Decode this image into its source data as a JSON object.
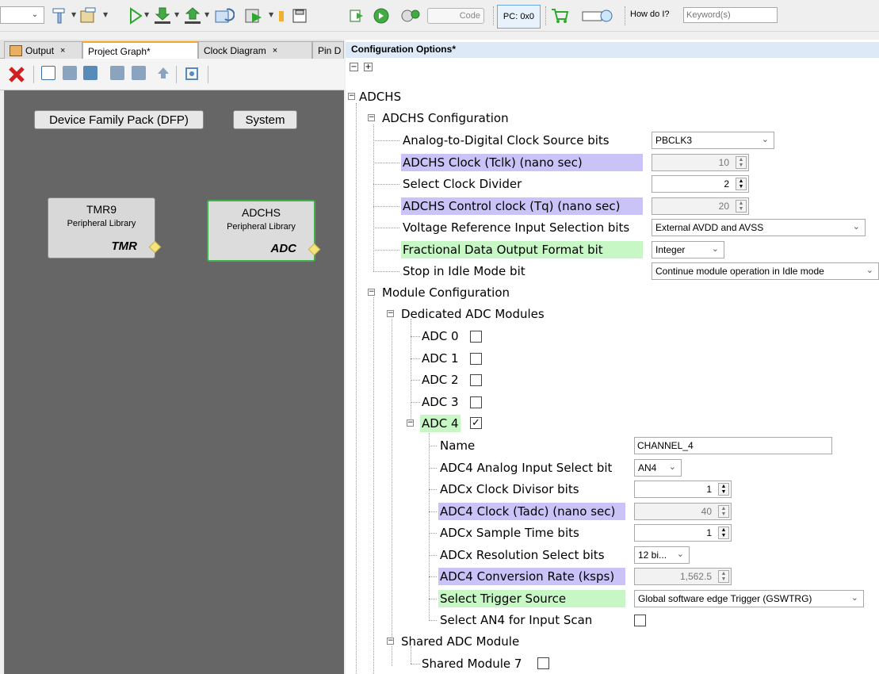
{
  "toolbar": {
    "pc_label": "PC: 0x0",
    "code_label": "Code",
    "how_do_i": "How do I?",
    "search_placeholder": "Keyword(s)"
  },
  "tabs": [
    {
      "label": "Output",
      "close": "×"
    },
    {
      "label": "Project Graph*",
      "close": ""
    },
    {
      "label": "Clock Diagram",
      "close": "×"
    },
    {
      "label": "Pin D",
      "close": ""
    }
  ],
  "graph": {
    "dfp_button": "Device Family Pack (DFP)",
    "system_button": "System",
    "nodes": [
      {
        "title": "TMR9",
        "subtitle": "Peripheral Library",
        "badge": "TMR"
      },
      {
        "title": "ADCHS",
        "subtitle": "Peripheral Library",
        "badge": "ADC"
      }
    ]
  },
  "config": {
    "header": "Configuration Options*",
    "collapse_all": "−",
    "expand_all": "+",
    "root": "ADCHS",
    "adchs_config": "ADCHS Configuration",
    "items": [
      {
        "label": "Analog-to-Digital Clock Source bits",
        "type": "select",
        "value": "PBCLK3",
        "hl": ""
      },
      {
        "label": "ADCHS Clock (Tclk) (nano sec)",
        "type": "spin-ro",
        "value": "10",
        "hl": "blue"
      },
      {
        "label": "Select Clock Divider",
        "type": "spin",
        "value": "2",
        "hl": ""
      },
      {
        "label": "ADCHS Control clock (Tq) (nano sec)",
        "type": "spin-ro",
        "value": "20",
        "hl": "blue"
      },
      {
        "label": "Voltage Reference Input Selection bits",
        "type": "select",
        "value": "External AVDD and AVSS",
        "hl": ""
      },
      {
        "label": "Fractional Data Output Format bit",
        "type": "select",
        "value": "Integer",
        "hl": "green"
      },
      {
        "label": "Stop in Idle Mode bit",
        "type": "select",
        "value": "Continue module operation in Idle mode",
        "hl": ""
      }
    ],
    "module_config": "Module Configuration",
    "dedicated": "Dedicated ADC Modules",
    "adc_list": [
      {
        "label": "ADC 0",
        "checked": false
      },
      {
        "label": "ADC 1",
        "checked": false
      },
      {
        "label": "ADC 2",
        "checked": false
      },
      {
        "label": "ADC 3",
        "checked": false
      }
    ],
    "adc4": {
      "label": "ADC 4",
      "checked": true
    },
    "adc4_items": [
      {
        "label": "Name",
        "type": "text",
        "value": "CHANNEL_4",
        "hl": ""
      },
      {
        "label": "ADC4 Analog Input Select bit",
        "type": "select",
        "value": "AN4",
        "hl": ""
      },
      {
        "label": "ADCx Clock Divisor bits",
        "type": "spin",
        "value": "1",
        "hl": ""
      },
      {
        "label": "ADC4 Clock (Tadc) (nano sec)",
        "type": "spin-ro",
        "value": "40",
        "hl": "blue"
      },
      {
        "label": "ADCx Sample Time bits",
        "type": "spin",
        "value": "1",
        "hl": ""
      },
      {
        "label": "ADCx Resolution Select bits",
        "type": "select",
        "value": "12 bi...",
        "hl": ""
      },
      {
        "label": "ADC4 Conversion Rate (ksps)",
        "type": "spin-ro",
        "value": "1,562.5",
        "hl": "blue"
      },
      {
        "label": "Select Trigger Source",
        "type": "select",
        "value": "Global software edge Trigger (GSWTRG)",
        "hl": "green"
      },
      {
        "label": "Select AN4 for Input Scan",
        "type": "checkbox",
        "value": "",
        "hl": ""
      }
    ],
    "shared": "Shared ADC Module",
    "shared_item": {
      "label": "Shared Module 7",
      "checked": false
    }
  }
}
